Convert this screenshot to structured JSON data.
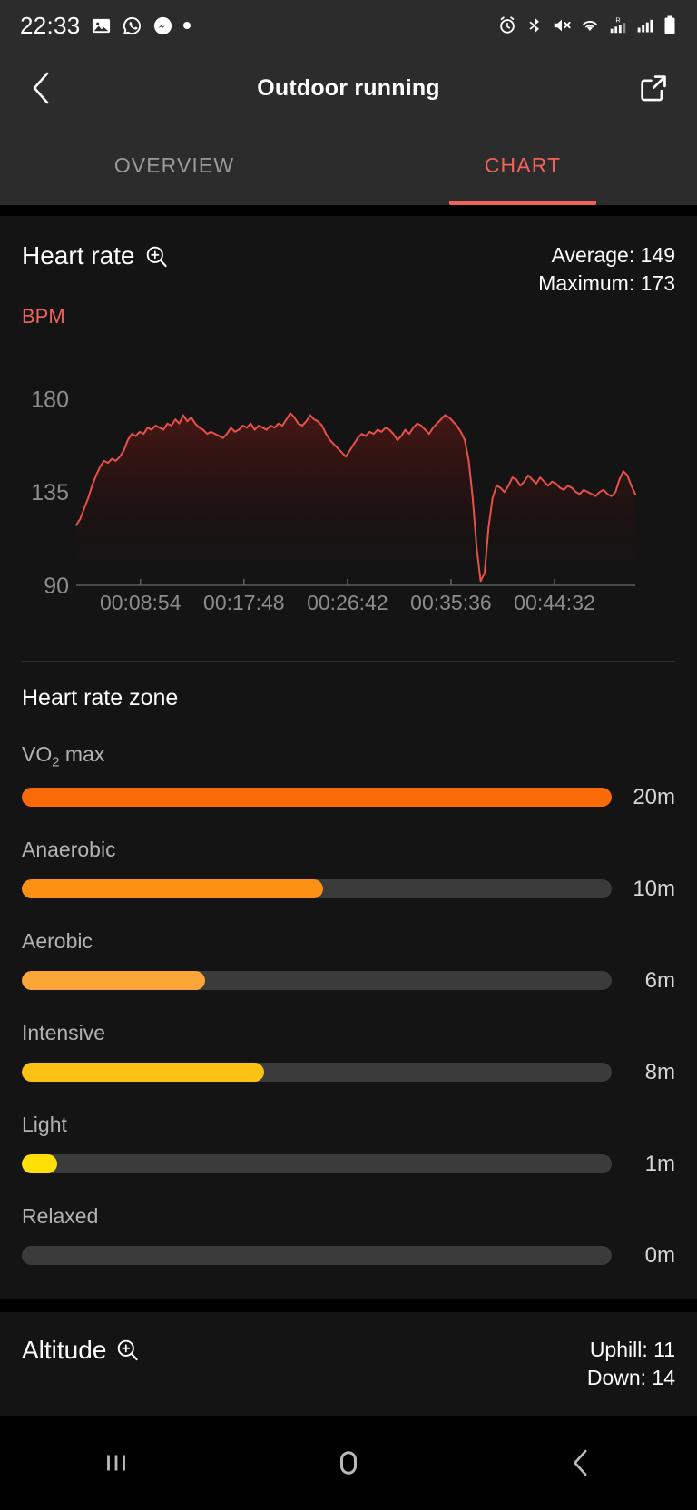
{
  "status_bar": {
    "time": "22:33",
    "left_icons": [
      "gallery-icon",
      "whatsapp-icon",
      "messenger-icon",
      "notification-dot"
    ],
    "right_icons": [
      "alarm-icon",
      "bluetooth-icon",
      "mute-icon",
      "wifi-icon",
      "signal-roaming-icon",
      "signal-icon",
      "battery-icon"
    ]
  },
  "header": {
    "title": "Outdoor running",
    "back_icon": "back-chevron-icon",
    "share_icon": "share-external-icon"
  },
  "tabs": [
    {
      "label": "OVERVIEW",
      "active": false
    },
    {
      "label": "CHART",
      "active": true
    }
  ],
  "heart_rate_card": {
    "title": "Heart rate",
    "zoom_icon": "magnifier-plus-icon",
    "average_label": "Average: 149",
    "maximum_label": "Maximum: 173",
    "unit_label": "BPM",
    "accent_color": "#f2615c"
  },
  "chart_data": {
    "type": "line",
    "title": "Heart rate",
    "ylabel": "BPM",
    "xlabel": "",
    "ylim": [
      90,
      195
    ],
    "yticks": [
      90,
      135,
      180
    ],
    "ytick_labels": [
      "90",
      "135",
      "180"
    ],
    "xtick_labels": [
      "00:08:54",
      "00:17:48",
      "00:26:42",
      "00:35:36",
      "00:44:32"
    ],
    "grid": false,
    "legend": "none",
    "line_color": "#e8504c",
    "fill": "gradient-dark-red",
    "average": 149,
    "maximum": 173,
    "values": [
      119,
      122,
      127,
      132,
      138,
      143,
      147,
      150,
      149,
      151,
      150,
      152,
      155,
      160,
      163,
      162,
      164,
      163,
      166,
      165,
      167,
      166,
      165,
      168,
      167,
      170,
      168,
      172,
      169,
      171,
      168,
      166,
      165,
      163,
      164,
      163,
      162,
      161,
      163,
      166,
      164,
      165,
      167,
      166,
      168,
      165,
      167,
      166,
      165,
      167,
      166,
      168,
      167,
      170,
      173,
      171,
      168,
      167,
      169,
      172,
      170,
      169,
      167,
      163,
      160,
      158,
      156,
      154,
      152,
      155,
      158,
      161,
      163,
      162,
      164,
      163,
      165,
      164,
      166,
      165,
      163,
      160,
      162,
      165,
      163,
      166,
      168,
      167,
      165,
      163,
      166,
      168,
      170,
      172,
      171,
      169,
      167,
      164,
      160,
      150,
      132,
      108,
      92,
      96,
      118,
      132,
      138,
      137,
      135,
      138,
      142,
      141,
      138,
      140,
      143,
      141,
      139,
      142,
      140,
      138,
      140,
      139,
      137,
      136,
      138,
      137,
      135,
      134,
      136,
      135,
      134,
      133,
      135,
      136,
      134,
      133,
      135,
      141,
      145,
      143,
      138,
      134
    ]
  },
  "zones_section": {
    "title": "Heart rate zone",
    "zones": [
      {
        "name": "VO2 max",
        "name_prefix": "VO",
        "name_sub": "2",
        "name_suffix": " max",
        "value": "20m",
        "percent": 100,
        "color": "#fa6a07"
      },
      {
        "name": "Anaerobic",
        "value": "10m",
        "percent": 51,
        "color": "#fb9013"
      },
      {
        "name": "Aerobic",
        "value": "6m",
        "percent": 31,
        "color": "#fca63a"
      },
      {
        "name": "Intensive",
        "value": "8m",
        "percent": 41,
        "color": "#fdc211"
      },
      {
        "name": "Light",
        "value": "1m",
        "percent": 6,
        "color": "#fee006"
      },
      {
        "name": "Relaxed",
        "value": "0m",
        "percent": 0,
        "color": "#3b3b3b"
      }
    ],
    "track_color": "#3b3b3b"
  },
  "altitude_card": {
    "title": "Altitude",
    "zoom_icon": "magnifier-plus-icon",
    "uphill_label": "Uphill: 11",
    "down_label": "Down: 14"
  },
  "nav_bar": {
    "recents_icon": "recent-apps-icon",
    "home_icon": "home-icon",
    "back_icon": "nav-back-icon"
  }
}
